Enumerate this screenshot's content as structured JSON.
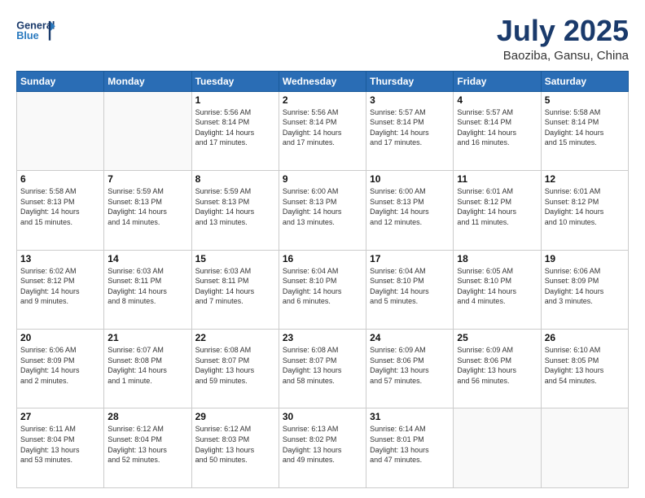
{
  "header": {
    "logo_line1": "General",
    "logo_line2": "Blue",
    "title": "July 2025",
    "subtitle": "Baoziba, Gansu, China"
  },
  "days_of_week": [
    "Sunday",
    "Monday",
    "Tuesday",
    "Wednesday",
    "Thursday",
    "Friday",
    "Saturday"
  ],
  "weeks": [
    [
      {
        "day": "",
        "info": ""
      },
      {
        "day": "",
        "info": ""
      },
      {
        "day": "1",
        "info": "Sunrise: 5:56 AM\nSunset: 8:14 PM\nDaylight: 14 hours\nand 17 minutes."
      },
      {
        "day": "2",
        "info": "Sunrise: 5:56 AM\nSunset: 8:14 PM\nDaylight: 14 hours\nand 17 minutes."
      },
      {
        "day": "3",
        "info": "Sunrise: 5:57 AM\nSunset: 8:14 PM\nDaylight: 14 hours\nand 17 minutes."
      },
      {
        "day": "4",
        "info": "Sunrise: 5:57 AM\nSunset: 8:14 PM\nDaylight: 14 hours\nand 16 minutes."
      },
      {
        "day": "5",
        "info": "Sunrise: 5:58 AM\nSunset: 8:14 PM\nDaylight: 14 hours\nand 15 minutes."
      }
    ],
    [
      {
        "day": "6",
        "info": "Sunrise: 5:58 AM\nSunset: 8:13 PM\nDaylight: 14 hours\nand 15 minutes."
      },
      {
        "day": "7",
        "info": "Sunrise: 5:59 AM\nSunset: 8:13 PM\nDaylight: 14 hours\nand 14 minutes."
      },
      {
        "day": "8",
        "info": "Sunrise: 5:59 AM\nSunset: 8:13 PM\nDaylight: 14 hours\nand 13 minutes."
      },
      {
        "day": "9",
        "info": "Sunrise: 6:00 AM\nSunset: 8:13 PM\nDaylight: 14 hours\nand 13 minutes."
      },
      {
        "day": "10",
        "info": "Sunrise: 6:00 AM\nSunset: 8:13 PM\nDaylight: 14 hours\nand 12 minutes."
      },
      {
        "day": "11",
        "info": "Sunrise: 6:01 AM\nSunset: 8:12 PM\nDaylight: 14 hours\nand 11 minutes."
      },
      {
        "day": "12",
        "info": "Sunrise: 6:01 AM\nSunset: 8:12 PM\nDaylight: 14 hours\nand 10 minutes."
      }
    ],
    [
      {
        "day": "13",
        "info": "Sunrise: 6:02 AM\nSunset: 8:12 PM\nDaylight: 14 hours\nand 9 minutes."
      },
      {
        "day": "14",
        "info": "Sunrise: 6:03 AM\nSunset: 8:11 PM\nDaylight: 14 hours\nand 8 minutes."
      },
      {
        "day": "15",
        "info": "Sunrise: 6:03 AM\nSunset: 8:11 PM\nDaylight: 14 hours\nand 7 minutes."
      },
      {
        "day": "16",
        "info": "Sunrise: 6:04 AM\nSunset: 8:10 PM\nDaylight: 14 hours\nand 6 minutes."
      },
      {
        "day": "17",
        "info": "Sunrise: 6:04 AM\nSunset: 8:10 PM\nDaylight: 14 hours\nand 5 minutes."
      },
      {
        "day": "18",
        "info": "Sunrise: 6:05 AM\nSunset: 8:10 PM\nDaylight: 14 hours\nand 4 minutes."
      },
      {
        "day": "19",
        "info": "Sunrise: 6:06 AM\nSunset: 8:09 PM\nDaylight: 14 hours\nand 3 minutes."
      }
    ],
    [
      {
        "day": "20",
        "info": "Sunrise: 6:06 AM\nSunset: 8:09 PM\nDaylight: 14 hours\nand 2 minutes."
      },
      {
        "day": "21",
        "info": "Sunrise: 6:07 AM\nSunset: 8:08 PM\nDaylight: 14 hours\nand 1 minute."
      },
      {
        "day": "22",
        "info": "Sunrise: 6:08 AM\nSunset: 8:07 PM\nDaylight: 13 hours\nand 59 minutes."
      },
      {
        "day": "23",
        "info": "Sunrise: 6:08 AM\nSunset: 8:07 PM\nDaylight: 13 hours\nand 58 minutes."
      },
      {
        "day": "24",
        "info": "Sunrise: 6:09 AM\nSunset: 8:06 PM\nDaylight: 13 hours\nand 57 minutes."
      },
      {
        "day": "25",
        "info": "Sunrise: 6:09 AM\nSunset: 8:06 PM\nDaylight: 13 hours\nand 56 minutes."
      },
      {
        "day": "26",
        "info": "Sunrise: 6:10 AM\nSunset: 8:05 PM\nDaylight: 13 hours\nand 54 minutes."
      }
    ],
    [
      {
        "day": "27",
        "info": "Sunrise: 6:11 AM\nSunset: 8:04 PM\nDaylight: 13 hours\nand 53 minutes."
      },
      {
        "day": "28",
        "info": "Sunrise: 6:12 AM\nSunset: 8:04 PM\nDaylight: 13 hours\nand 52 minutes."
      },
      {
        "day": "29",
        "info": "Sunrise: 6:12 AM\nSunset: 8:03 PM\nDaylight: 13 hours\nand 50 minutes."
      },
      {
        "day": "30",
        "info": "Sunrise: 6:13 AM\nSunset: 8:02 PM\nDaylight: 13 hours\nand 49 minutes."
      },
      {
        "day": "31",
        "info": "Sunrise: 6:14 AM\nSunset: 8:01 PM\nDaylight: 13 hours\nand 47 minutes."
      },
      {
        "day": "",
        "info": ""
      },
      {
        "day": "",
        "info": ""
      }
    ]
  ]
}
